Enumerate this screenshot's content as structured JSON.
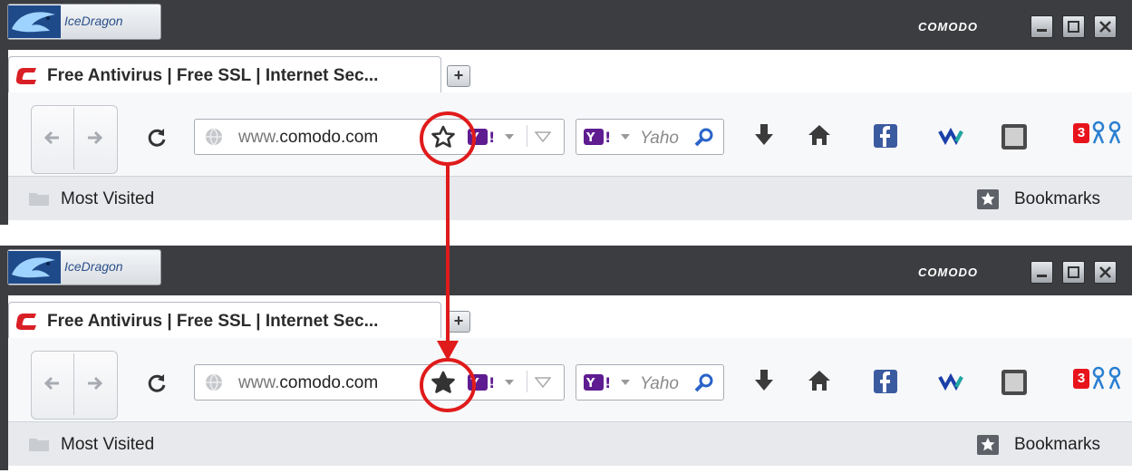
{
  "screens": [
    {
      "app": {
        "brand": "IceDragon",
        "vendor": "COMODO"
      },
      "tab": {
        "title": "Free Antivirus | Free SSL | Internet Sec..."
      },
      "url": {
        "prefix": "www.",
        "domain": "comodo.com"
      },
      "bookmark_star_state": "unstarred",
      "search": {
        "placeholder": "Yaho"
      },
      "notification_count": "3",
      "bookmarks_bar": {
        "most_visited": "Most Visited",
        "bookmarks": "Bookmarks"
      }
    },
    {
      "app": {
        "brand": "IceDragon",
        "vendor": "COMODO"
      },
      "tab": {
        "title": "Free Antivirus | Free SSL | Internet Sec..."
      },
      "url": {
        "prefix": "www.",
        "domain": "comodo.com"
      },
      "bookmark_star_state": "starred",
      "search": {
        "placeholder": "Yaho"
      },
      "notification_count": "3",
      "bookmarks_bar": {
        "most_visited": "Most Visited",
        "bookmarks": "Bookmarks"
      }
    }
  ],
  "colors": {
    "titlebar": "#3c3d40",
    "annotation_red": "#e01b1b",
    "yahoo_purple": "#5f1c91",
    "badge_red": "#e8141c"
  },
  "annotation": {
    "type": "arrow-between-highlight-circles",
    "meaning": "bookmark star toggles to filled"
  }
}
